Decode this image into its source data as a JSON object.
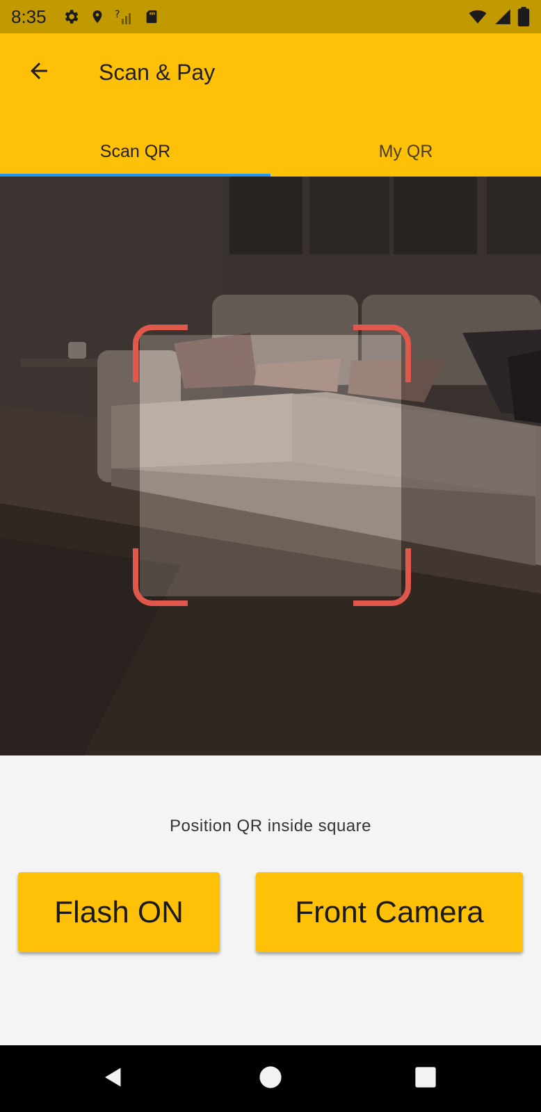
{
  "status_bar": {
    "time": "8:35",
    "icons_left": [
      "settings-icon",
      "location-icon",
      "no-signal-icon",
      "sd-card-icon"
    ],
    "icons_right": [
      "wifi-icon",
      "cell-signal-icon",
      "battery-icon"
    ]
  },
  "app_bar": {
    "title": "Scan & Pay",
    "back_icon": "arrow-back-icon",
    "background": "#ffc107"
  },
  "tabs": [
    {
      "label": "Scan QR",
      "active": true
    },
    {
      "label": "My QR",
      "active": false
    }
  ],
  "accent_colors": {
    "tab_indicator": "#2196f3",
    "scan_frame": "#e0574c",
    "button": "#ffc107"
  },
  "scanner": {
    "hint": "Position QR inside square"
  },
  "buttons": {
    "flash": "Flash ON",
    "front_camera": "Front Camera"
  },
  "nav_bar": {
    "icons": [
      "back-triangle-icon",
      "home-circle-icon",
      "recents-square-icon"
    ]
  }
}
